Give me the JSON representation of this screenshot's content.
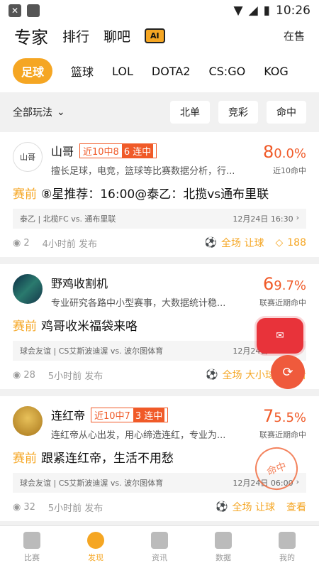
{
  "status": {
    "time": "10:26"
  },
  "topnav": {
    "items": [
      "专家",
      "排行",
      "聊吧"
    ],
    "ai_label": "AI",
    "right": "在售"
  },
  "sport_tabs": [
    "足球",
    "篮球",
    "LOL",
    "DOTA2",
    "CS:GO",
    "KOG"
  ],
  "filter": {
    "all_label": "全部玩法",
    "pills": [
      "北单",
      "竞彩",
      "命中"
    ]
  },
  "cards": [
    {
      "avatar_text": "山哥",
      "name": "山哥",
      "tag_text": "近10中8",
      "tag_highlight": "6 连中",
      "desc": "擅长足球，电竞，篮球等比赛数据分析，行...",
      "rate_big": "8",
      "rate_rest": "0.0%",
      "rate_label": "近10命中",
      "pre": "赛前",
      "title": "⑧星推荐：16:00@泰乙：北揽vs通布里联",
      "match": "泰乙 | 北榄FC vs. 通布里联",
      "match_time": "12月24日 16:30",
      "views": "2",
      "ago": "4小时前 发布",
      "play": "全场 让球",
      "extra": "188"
    },
    {
      "avatar_text": "",
      "name": "野鸡收割机",
      "tag_text": "",
      "tag_highlight": "",
      "desc": "专业研究各路中小型赛事，大数据统计稳...",
      "rate_big": "6",
      "rate_rest": "9.7%",
      "rate_label": "联赛近期命中",
      "pre": "赛前",
      "title": "鸡哥收米福袋来咯",
      "match": "球会友谊 | CS艾斯波迪渥 vs. 波尔图体育",
      "match_time": "12月24日 06:00",
      "views": "28",
      "ago": "5小时前 发布",
      "play": "全场 大小球",
      "extra": "查看"
    },
    {
      "avatar_text": "",
      "name": "连红帝",
      "tag_text": "近10中7",
      "tag_highlight": "3 连中",
      "desc": "连红帝从心出发，用心缔造连红，专业为...",
      "rate_big": "7",
      "rate_rest": "5.5%",
      "rate_label": "联赛近期命中",
      "pre": "赛前",
      "title": "跟紧连红帝，生活不用愁",
      "match": "球会友谊 | CS艾斯波迪渥 vs. 波尔图体育",
      "match_time": "12月24日 06:00",
      "views": "32",
      "ago": "5小时前 发布",
      "play": "全场 让球",
      "extra": "查看"
    }
  ],
  "stamp_text": "命中",
  "bottom_nav": [
    "比赛",
    "发现",
    "资讯",
    "数据",
    "我的"
  ]
}
